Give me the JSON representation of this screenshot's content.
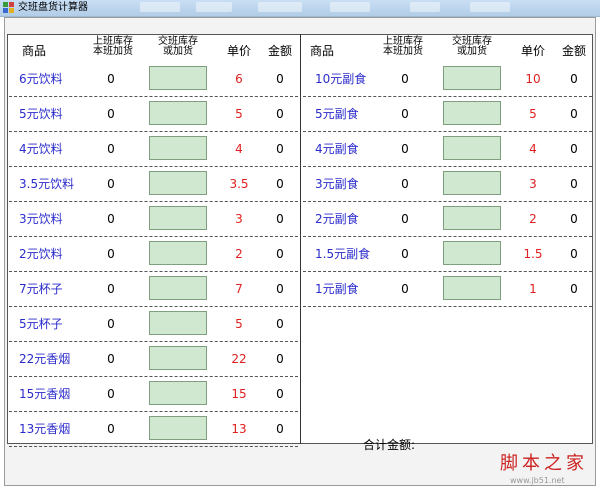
{
  "window": {
    "title": "交班盘货计算器"
  },
  "headers": {
    "name": "商品",
    "prev_line1": "上班库存",
    "prev_line2": "本班加货",
    "handover_line1": "交班库存",
    "handover_line2": "或加货",
    "price": "单价",
    "amount": "金额"
  },
  "left_items": [
    {
      "name": "6元饮料",
      "prev": "0",
      "price": "6",
      "amount": "0"
    },
    {
      "name": "5元饮料",
      "prev": "0",
      "price": "5",
      "amount": "0"
    },
    {
      "name": "4元饮料",
      "prev": "0",
      "price": "4",
      "amount": "0"
    },
    {
      "name": "3.5元饮料",
      "prev": "0",
      "price": "3.5",
      "amount": "0"
    },
    {
      "name": "3元饮料",
      "prev": "0",
      "price": "3",
      "amount": "0"
    },
    {
      "name": "2元饮料",
      "prev": "0",
      "price": "2",
      "amount": "0"
    },
    {
      "name": "7元杯子",
      "prev": "0",
      "price": "7",
      "amount": "0"
    },
    {
      "name": "5元杯子",
      "prev": "0",
      "price": "5",
      "amount": "0"
    },
    {
      "name": "22元香烟",
      "prev": "0",
      "price": "22",
      "amount": "0"
    },
    {
      "name": "15元香烟",
      "prev": "0",
      "price": "15",
      "amount": "0"
    },
    {
      "name": "13元香烟",
      "prev": "0",
      "price": "13",
      "amount": "0"
    }
  ],
  "right_items": [
    {
      "name": "10元副食",
      "prev": "0",
      "price": "10",
      "amount": "0"
    },
    {
      "name": "5元副食",
      "prev": "0",
      "price": "5",
      "amount": "0"
    },
    {
      "name": "4元副食",
      "prev": "0",
      "price": "4",
      "amount": "0"
    },
    {
      "name": "3元副食",
      "prev": "0",
      "price": "3",
      "amount": "0"
    },
    {
      "name": "2元副食",
      "prev": "0",
      "price": "2",
      "amount": "0"
    },
    {
      "name": "1.5元副食",
      "prev": "0",
      "price": "1.5",
      "amount": "0"
    },
    {
      "name": "1元副食",
      "prev": "0",
      "price": "1",
      "amount": "0"
    }
  ],
  "total": {
    "label": "合计金额:"
  },
  "watermark": {
    "text": "脚本之家",
    "url": "www.jb51.net"
  },
  "colors": {
    "name": "#2b2bcc",
    "price": "#e02020",
    "input": "#cfe8cf"
  }
}
